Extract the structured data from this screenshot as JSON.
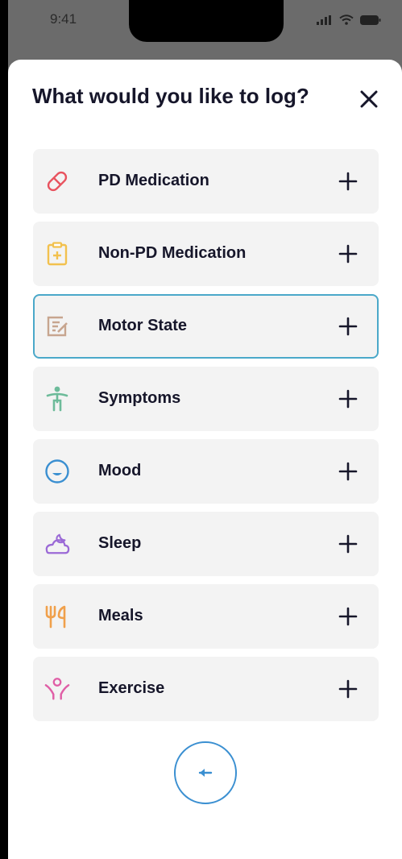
{
  "status_bar": {
    "time": "9:41"
  },
  "sheet": {
    "title": "What would you like to log?",
    "close_icon": "close-icon"
  },
  "log_items": [
    {
      "label": "PD Medication",
      "icon": "pill-icon",
      "color": "#e8525e"
    },
    {
      "label": "Non-PD Medication",
      "icon": "clipboard-plus-icon",
      "color": "#f2c14e"
    },
    {
      "label": "Motor State",
      "icon": "note-edit-icon",
      "color": "#c7a58f",
      "selected": true
    },
    {
      "label": "Symptoms",
      "icon": "body-icon",
      "color": "#6dbb9a"
    },
    {
      "label": "Mood",
      "icon": "face-icon",
      "color": "#3a8fd1"
    },
    {
      "label": "Sleep",
      "icon": "moon-cloud-icon",
      "color": "#9b6ad6"
    },
    {
      "label": "Meals",
      "icon": "utensils-icon",
      "color": "#f0a04b"
    },
    {
      "label": "Exercise",
      "icon": "person-arms-up-icon",
      "color": "#e05ea6"
    }
  ],
  "colors": {
    "selected_border": "#4aa8c9",
    "text_dark": "#16162a",
    "back_button": "#3a8fd1"
  },
  "back_button_icon": "arrow-left-icon"
}
